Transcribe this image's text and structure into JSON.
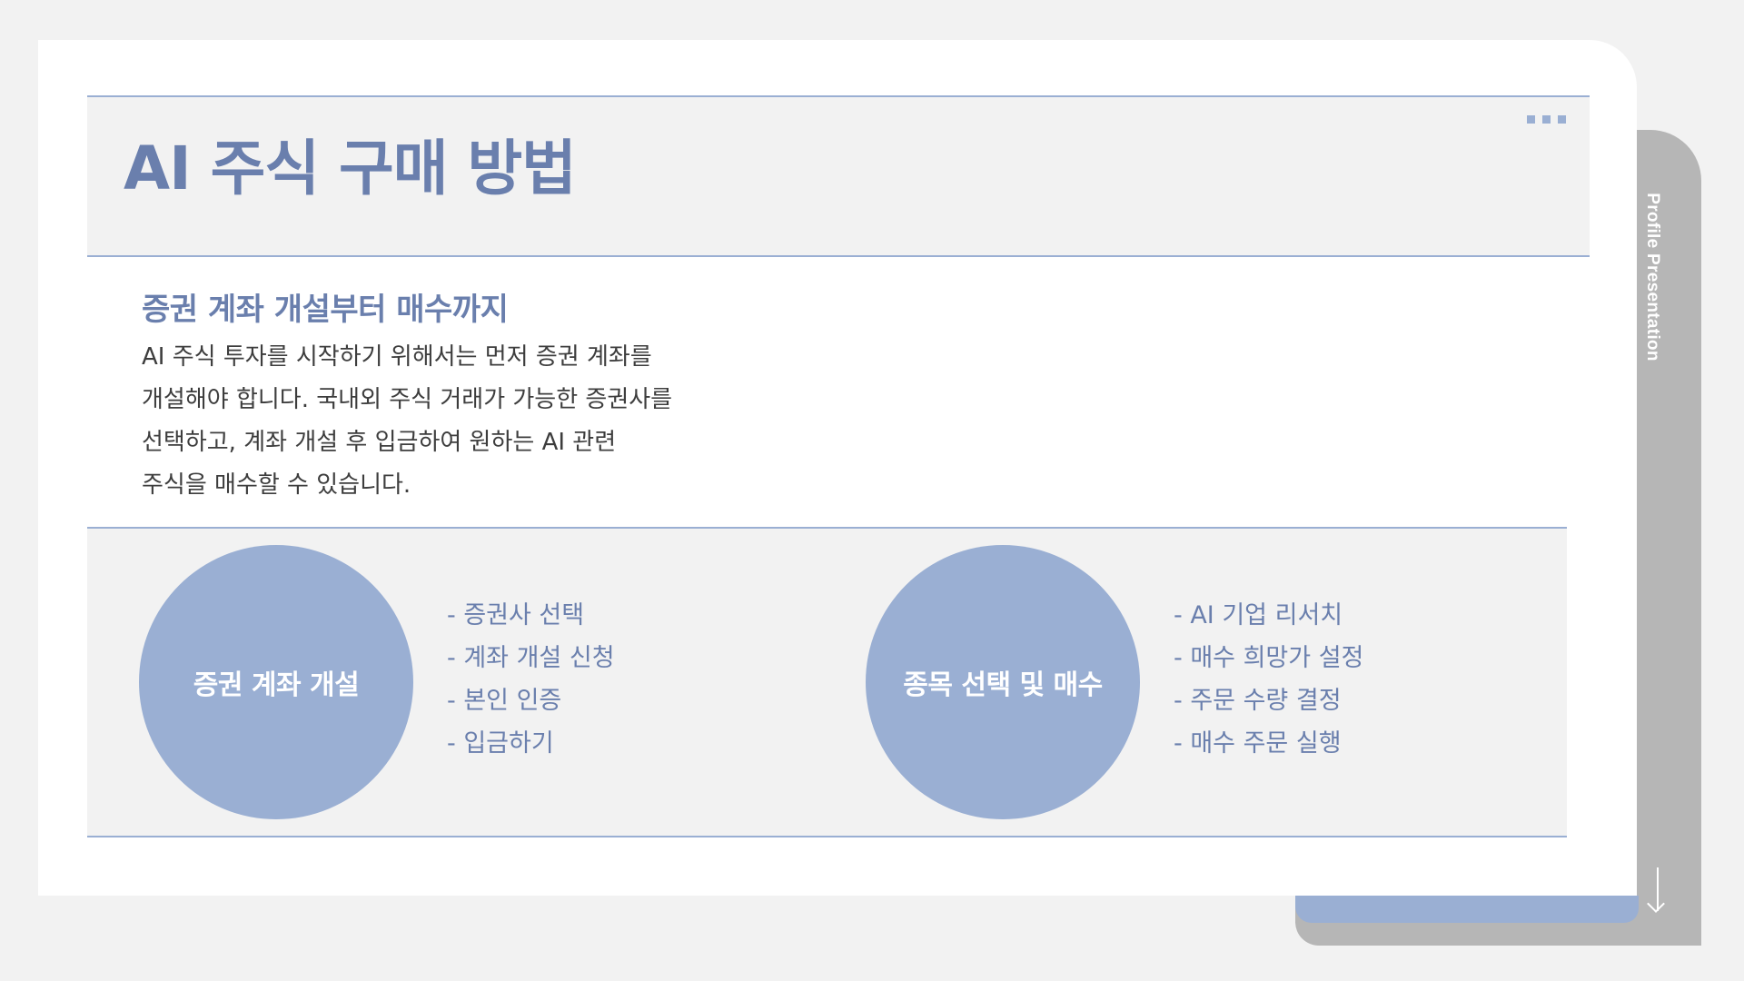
{
  "side_tab": {
    "label": "Profile Presentation"
  },
  "title": "AI 주식 구매 방법",
  "subtitle": "증권 계좌 개설부터 매수까지",
  "body_lines": [
    "AI 주식 투자를 시작하기 위해서는 먼저 증권 계좌를",
    "개설해야 합니다. 국내외 주식 거래가 가능한 증권사를",
    "선택하고, 계좌 개설 후 입금하여 원하는 AI 관련",
    "주식을 매수할 수 있습니다."
  ],
  "steps": [
    {
      "title": "증권 계좌 개설",
      "items": [
        "- 증권사 선택",
        "- 계좌 개설 신청",
        "- 본인 인증",
        "- 입금하기"
      ]
    },
    {
      "title": "종목 선택 및 매수",
      "items": [
        "- AI 기업 리서치",
        "- 매수 희망가 설정",
        "- 주문 수량 결정",
        "- 매수 주문 실행"
      ]
    }
  ],
  "colors": {
    "accent": "#6a7fad",
    "accent_light": "#9aafd3",
    "band_bg": "#f2f2f2",
    "tab_grey": "#b6b6b6"
  },
  "icons": {
    "more": "more-dots-icon",
    "down": "arrow-down-icon"
  }
}
